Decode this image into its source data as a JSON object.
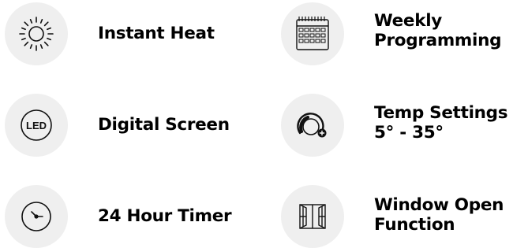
{
  "features": [
    {
      "icon": "sun-icon",
      "lines": [
        "Instant Heat"
      ]
    },
    {
      "icon": "calendar-icon",
      "lines": [
        "Weekly",
        "Programming"
      ]
    },
    {
      "icon": "led-icon",
      "icon_text": "LED",
      "lines": [
        "Digital Screen"
      ]
    },
    {
      "icon": "temperature-dial-icon",
      "lines": [
        "Temp Settings",
        "5° - 35°"
      ]
    },
    {
      "icon": "clock-icon",
      "lines": [
        "24 Hour Timer"
      ]
    },
    {
      "icon": "window-icon",
      "lines": [
        "Window Open",
        "Function"
      ]
    }
  ],
  "colors": {
    "icon_background": "#efefef",
    "icon_stroke": "#111111",
    "text": "#000000"
  }
}
